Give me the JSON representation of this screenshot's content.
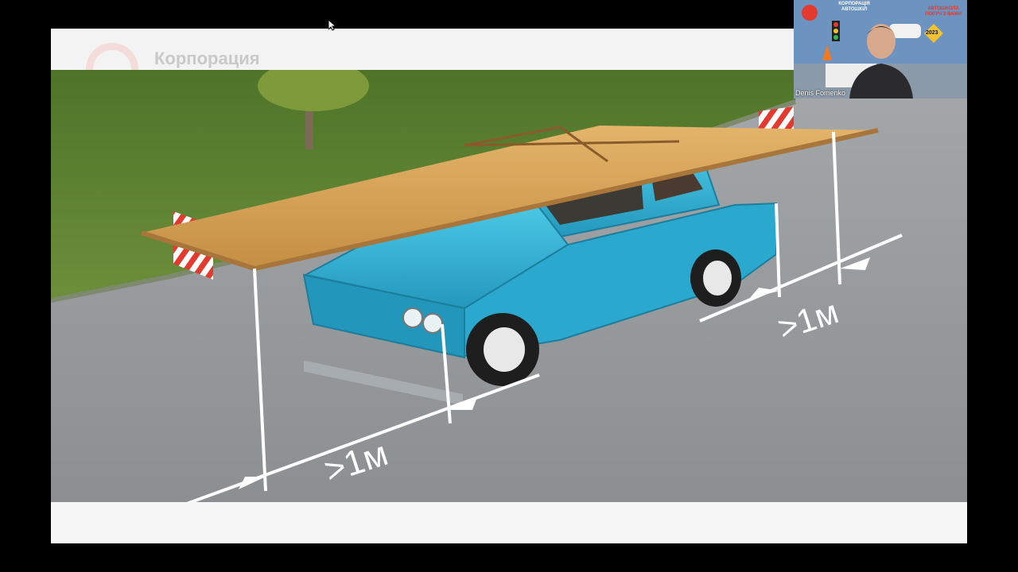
{
  "slide": {
    "watermark_text": "Корпорация",
    "measure_left": ">1м",
    "measure_right": ">1м"
  },
  "video_tile": {
    "speaker_name": "Denis Fomenko",
    "banner_brand": "КОРПОРАЦІЯ АВТОШКІЛ",
    "banner_slogan": "АВТОШКОЛА ПОРУЧ З ВАМИ",
    "banner_year": "2023"
  },
  "colors": {
    "car": "#2fb6d8",
    "board": "#d9a85b",
    "road": "#8f9294",
    "grass": "#5a7e2f",
    "marker": "#e23a2e"
  },
  "icons": [
    "cursor-icon",
    "warning-stripe-icon",
    "traffic-light-icon"
  ]
}
